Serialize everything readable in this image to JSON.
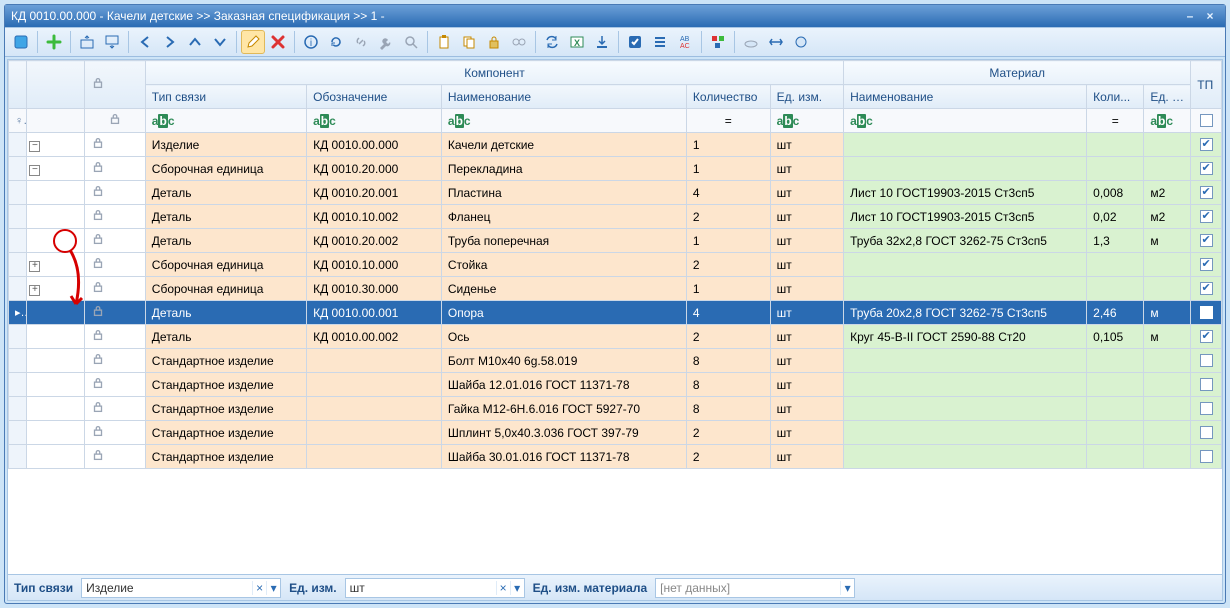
{
  "title": "КД 0010.00.000 - Качели детские >> Заказная спецификация >> 1 -",
  "headers": {
    "group_component": "Компонент",
    "group_material": "Материал",
    "link_type": "Тип связи",
    "designation": "Обозначение",
    "name": "Наименование",
    "qty": "Количество",
    "uom": "Ед. изм.",
    "mat_name": "Наименование",
    "mat_qty": "Коли...",
    "mat_uom": "Ед. и...",
    "tp": "ТП"
  },
  "rows": [
    {
      "depth": 0,
      "toggle": "-",
      "type": "Изделие",
      "code": "КД 0010.00.000",
      "name": "Качели детские",
      "qty": "1",
      "uom": "шт",
      "mat": "",
      "mqty": "",
      "muom": "",
      "tp": true
    },
    {
      "depth": 1,
      "toggle": "-",
      "type": "Сборочная единица",
      "code": "КД 0010.20.000",
      "name": "Перекладина",
      "qty": "1",
      "uom": "шт",
      "mat": "",
      "mqty": "",
      "muom": "",
      "tp": true
    },
    {
      "depth": 2,
      "toggle": "",
      "type": "Деталь",
      "code": "КД 0010.20.001",
      "name": "Пластина",
      "qty": "4",
      "uom": "шт",
      "mat": "Лист 10 ГОСТ19903-2015 Ст3сп5",
      "mqty": "0,008",
      "muom": "м2",
      "tp": true
    },
    {
      "depth": 2,
      "toggle": "",
      "type": "Деталь",
      "code": "КД 0010.10.002",
      "name": "Фланец",
      "qty": "2",
      "uom": "шт",
      "mat": "Лист 10 ГОСТ19903-2015 Ст3сп5",
      "mqty": "0,02",
      "muom": "м2",
      "tp": true
    },
    {
      "depth": 2,
      "toggle": "",
      "type": "Деталь",
      "code": "КД 0010.20.002",
      "name": "Труба поперечная",
      "qty": "1",
      "uom": "шт",
      "mat": "Труба 32х2,8 ГОСТ 3262-75 Ст3сп5",
      "mqty": "1,3",
      "muom": "м",
      "tp": true
    },
    {
      "depth": 1,
      "toggle": "+",
      "type": "Сборочная единица",
      "code": "КД 0010.10.000",
      "name": "Стойка",
      "qty": "2",
      "uom": "шт",
      "mat": "",
      "mqty": "",
      "muom": "",
      "tp": true
    },
    {
      "depth": 1,
      "toggle": "+",
      "type": "Сборочная единица",
      "code": "КД 0010.30.000",
      "name": "Сиденье",
      "qty": "1",
      "uom": "шт",
      "mat": "",
      "mqty": "",
      "muom": "",
      "tp": true
    },
    {
      "depth": 1,
      "toggle": "",
      "type": "Деталь",
      "code": "КД 0010.00.001",
      "name": "Опора",
      "qty": "4",
      "uom": "шт",
      "mat": "Труба 20х2,8 ГОСТ 3262-75 Ст3сп5",
      "mqty": "2,46",
      "muom": "м",
      "tp": true,
      "selected": true
    },
    {
      "depth": 1,
      "toggle": "",
      "type": "Деталь",
      "code": "КД 0010.00.002",
      "name": "Ось",
      "qty": "2",
      "uom": "шт",
      "mat": "Круг 45-В-II  ГОСТ 2590-88 Ст20",
      "mqty": "0,105",
      "muom": "м",
      "tp": true
    },
    {
      "depth": 1,
      "toggle": "",
      "type": "Стандартное изделие",
      "code": "",
      "name": "Болт М10х40 6g.58.019",
      "qty": "8",
      "uom": "шт",
      "mat": "",
      "mqty": "",
      "muom": "",
      "tp": false
    },
    {
      "depth": 1,
      "toggle": "",
      "type": "Стандартное изделие",
      "code": "",
      "name": "Шайба 12.01.016 ГОСТ 11371-78",
      "qty": "8",
      "uom": "шт",
      "mat": "",
      "mqty": "",
      "muom": "",
      "tp": false
    },
    {
      "depth": 1,
      "toggle": "",
      "type": "Стандартное изделие",
      "code": "",
      "name": "Гайка М12-6Н.6.016 ГОСТ 5927-70",
      "qty": "8",
      "uom": "шт",
      "mat": "",
      "mqty": "",
      "muom": "",
      "tp": false
    },
    {
      "depth": 1,
      "toggle": "",
      "type": "Стандартное изделие",
      "code": "",
      "name": "Шплинт 5,0х40.3.036 ГОСТ 397-79",
      "qty": "2",
      "uom": "шт",
      "mat": "",
      "mqty": "",
      "muom": "",
      "tp": false
    },
    {
      "depth": 1,
      "toggle": "",
      "type": "Стандартное изделие",
      "code": "",
      "name": "Шайба 30.01.016 ГОСТ 11371-78",
      "qty": "2",
      "uom": "шт",
      "mat": "",
      "mqty": "",
      "muom": "",
      "tp": false
    }
  ],
  "bottom": {
    "link_type_label": "Тип связи",
    "link_type_value": "Изделие",
    "uom_label": "Ед. изм.",
    "uom_value": "шт",
    "mat_uom_label": "Ед. изм. материала",
    "mat_uom_value": "[нет данных]"
  },
  "filter_tokens": {
    "eq": "=",
    "abc": "abc"
  },
  "select_marker": "▸"
}
